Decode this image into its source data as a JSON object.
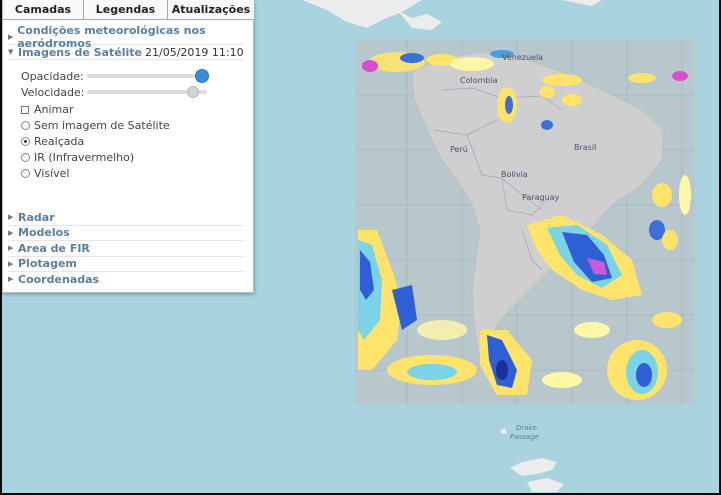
{
  "tabs": [
    {
      "label": "Camadas"
    },
    {
      "label": "Legendas"
    },
    {
      "label": "Atualizações"
    }
  ],
  "sections": {
    "aerodromos": "Condições meteorológicas nos aeródromos",
    "satellite_title": "Imagens de Satélite",
    "satellite_timestamp": "21/05/2019 11:10"
  },
  "satellite": {
    "opacity_label": "Opacidade:",
    "opacity_value": 1.0,
    "speed_label": "Velocidade:",
    "speed_value": 0.85,
    "animate_label": "Animar",
    "options": [
      {
        "label": "Sem imagem de Satélite",
        "selected": false
      },
      {
        "label": "Realçada",
        "selected": true
      },
      {
        "label": "IR (Infravermelho)",
        "selected": false
      },
      {
        "label": "Visível",
        "selected": false
      }
    ]
  },
  "lower_sections": [
    {
      "label": "Radar"
    },
    {
      "label": "Modelos"
    },
    {
      "label": "Area de FIR"
    },
    {
      "label": "Plotagem"
    },
    {
      "label": "Coordenadas"
    }
  ],
  "map_labels": {
    "venezuela": "Venezuela",
    "colombia": "Colombia",
    "peru": "Perú",
    "brasil": "Brasil",
    "bolivia": "Bolivia",
    "paraguay": "Paraguay",
    "drake": "Drake",
    "passage": "Passage"
  },
  "colors": {
    "ocean": "#a9d3df",
    "land": "#ececec",
    "land_under_overlay": "#cfcfcf",
    "section_blue": "#5a7fa0",
    "slider_knob": "#3a8ed6"
  }
}
